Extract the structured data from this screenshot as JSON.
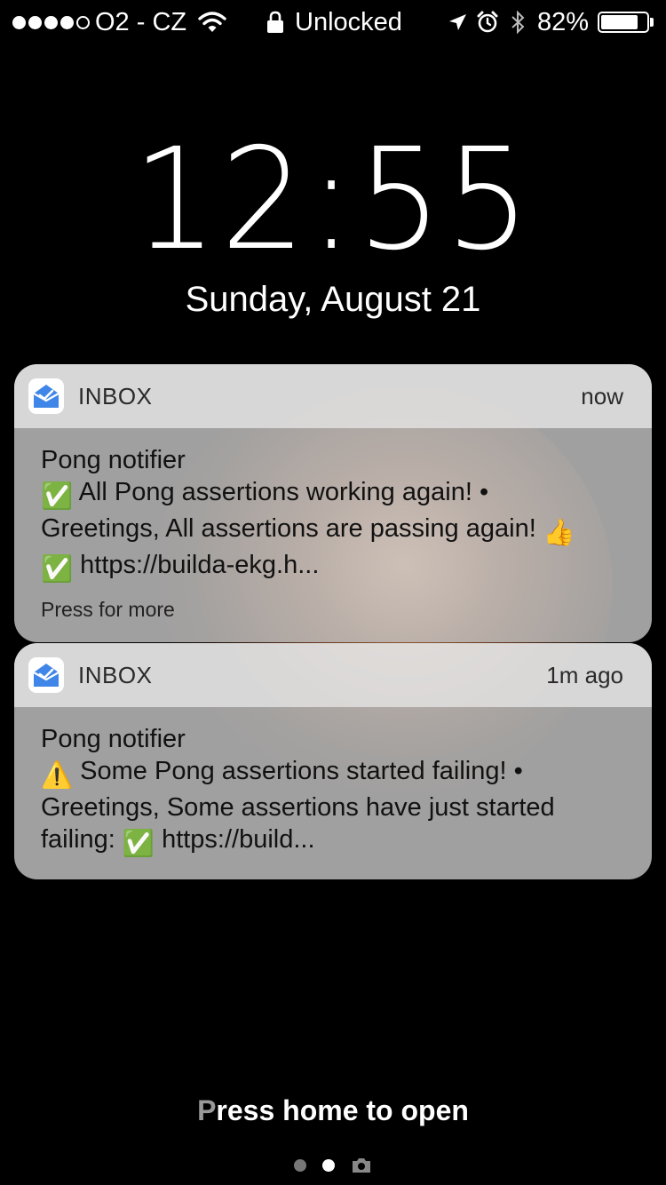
{
  "status_bar": {
    "signal_dots_filled": 4,
    "signal_dots_total": 5,
    "carrier": "O2 - CZ",
    "lock_status": "Unlocked",
    "battery_percent": "82%",
    "battery_level": 0.82
  },
  "lock_screen": {
    "time": "12:55",
    "date": "Sunday, August 21"
  },
  "notifications": [
    {
      "app": "INBOX",
      "time": "now",
      "title": "Pong notifier",
      "line1_emoji": "✅",
      "line1_text": "All Pong assertions working again!",
      "bullet": "•",
      "line2_text": "Greetings, All assertions are passing again!",
      "line2_emoji": "👍",
      "line3_emoji": "✅",
      "line3_text": "https://builda-ekg.h...",
      "more": "Press for more"
    },
    {
      "app": "INBOX",
      "time": "1m ago",
      "title": "Pong notifier",
      "line1_emoji": "⚠️",
      "line1_text": "Some Pong assertions started failing!",
      "bullet": "•",
      "line2_text": "Greetings, Some assertions have just started",
      "line3_text": "failing:",
      "line3_emoji": "✅",
      "line3_link": "https://build..."
    }
  ],
  "footer": {
    "press_home_first": "P",
    "press_home_rest": "ress home to open"
  },
  "colors": {
    "app_icon_blue": "#3f86e8",
    "check_green": "#5fbf3f",
    "warning_yellow": "#f4c430"
  },
  "icons": [
    "wifi-icon",
    "lock-icon",
    "location-icon",
    "alarm-icon",
    "bluetooth-icon",
    "battery-icon",
    "inbox-app-icon",
    "camera-icon"
  ]
}
